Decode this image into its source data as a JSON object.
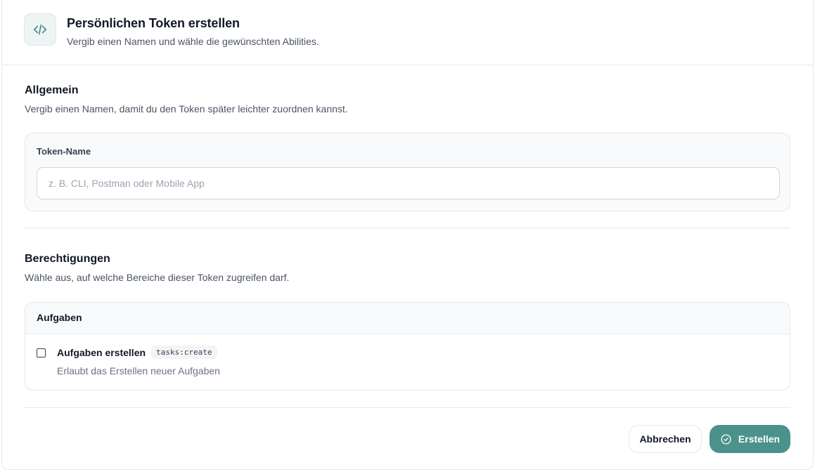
{
  "header": {
    "icon": "code-icon",
    "title": "Persönlichen Token erstellen",
    "subtitle": "Vergib einen Namen und wähle die gewünschten Abilities."
  },
  "general": {
    "title": "Allgemein",
    "subtitle": "Vergib einen Namen, damit du den Token später leichter zuordnen kannst.",
    "field_label": "Token-Name",
    "field_value": "",
    "field_placeholder": "z. B. CLI, Postman oder Mobile App"
  },
  "permissions": {
    "title": "Berechtigungen",
    "subtitle": "Wähle aus, auf welche Bereiche dieser Token zugreifen darf.",
    "groups": [
      {
        "title": "Aufgaben",
        "abilities": [
          {
            "name": "Aufgaben erstellen",
            "code": "tasks:create",
            "description": "Erlaubt das Erstellen neuer Aufgaben",
            "checked": false
          }
        ]
      }
    ]
  },
  "footer": {
    "cancel_label": "Abbrechen",
    "submit_label": "Erstellen",
    "submit_icon": "check-circle-icon"
  },
  "colors": {
    "accent": "#4a928b",
    "icon_bg": "#eef4f3"
  }
}
